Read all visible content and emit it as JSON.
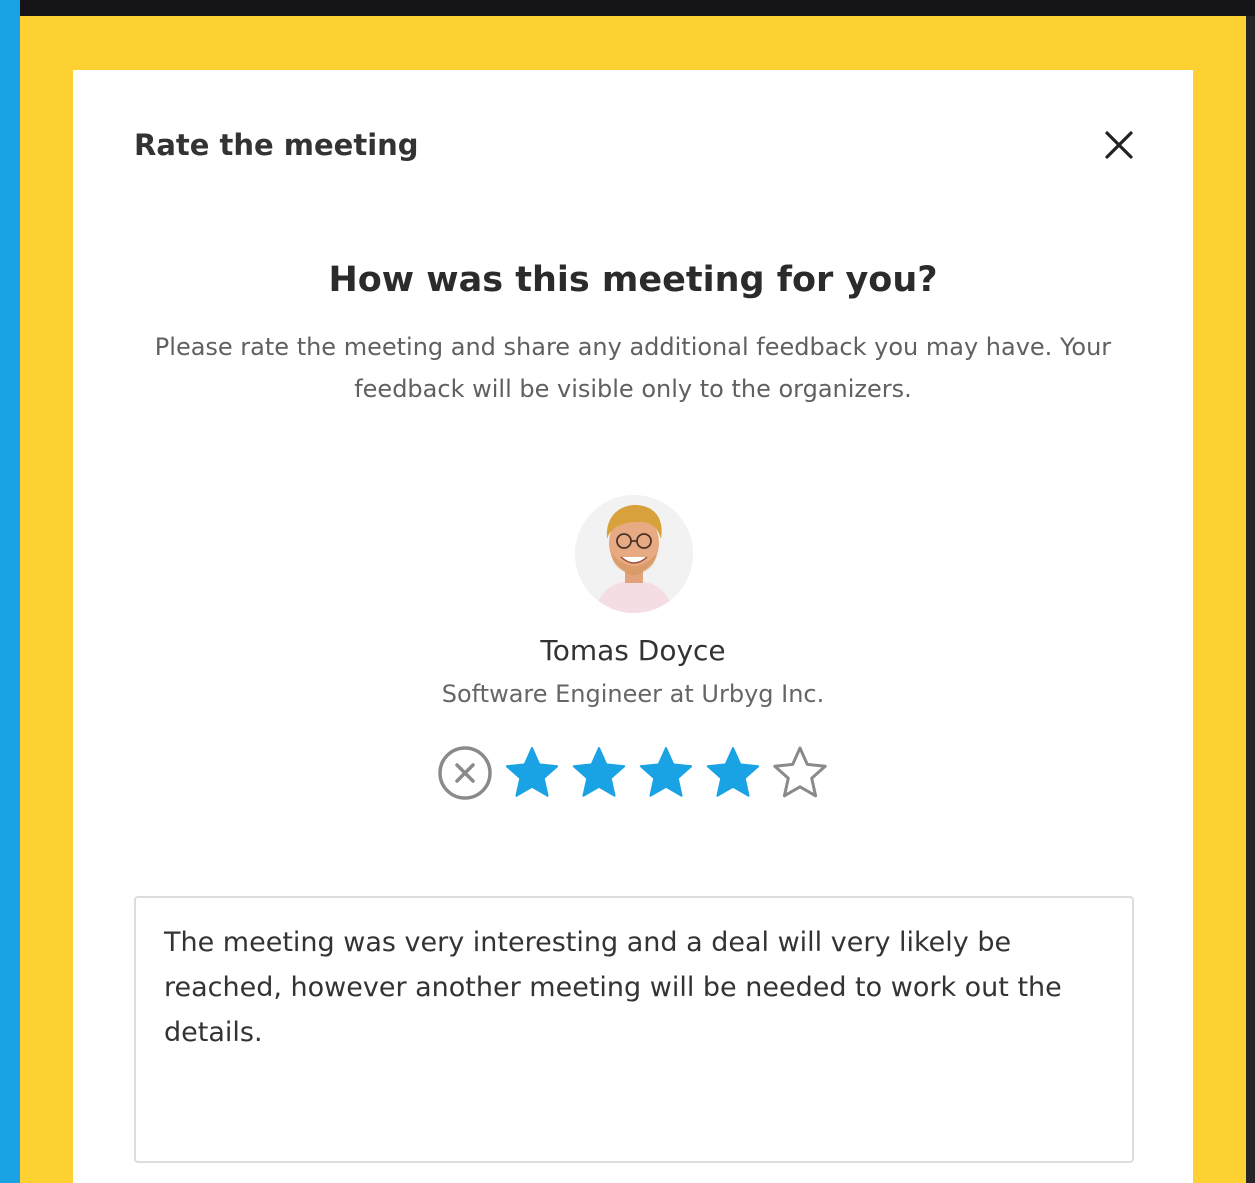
{
  "dialog": {
    "title": "Rate the meeting",
    "close_icon": "close-icon"
  },
  "prompt": {
    "headline": "How was this meeting for you?",
    "subtext": "Please rate the meeting and share any additional feedback you may have. Your feedback will be visible only to the organizers."
  },
  "person": {
    "name": "Tomas Doyce",
    "role": "Software Engineer at Urbyg Inc.",
    "avatar_icon": "avatar-photo"
  },
  "rating": {
    "value": 4,
    "max": 5,
    "clear_icon": "circle-x-icon",
    "filled_color": "#1aa3e4",
    "empty_color": "#8a8a8a"
  },
  "feedback": {
    "value": "The meeting was very interesting and a deal will very likely be reached, however another meeting will be needed to work out the details."
  },
  "colors": {
    "frame": "#fdd132",
    "accent": "#1aa3e4"
  }
}
